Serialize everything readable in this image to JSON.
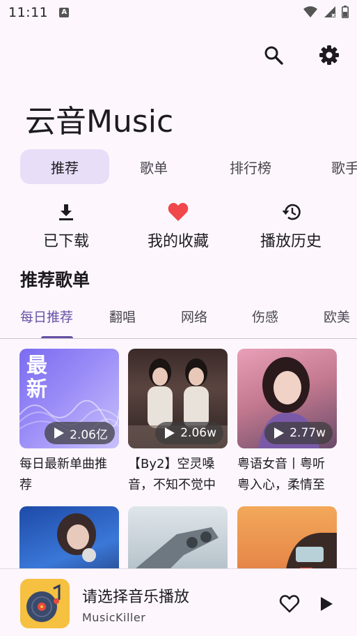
{
  "status_bar": {
    "time": "11:11"
  },
  "app": {
    "title": "云音Music"
  },
  "icons": {
    "search": "search-icon",
    "settings": "gear-icon"
  },
  "main_tabs": [
    "推荐",
    "歌单",
    "排行榜",
    "歌手"
  ],
  "quick_actions": [
    {
      "label": "已下载",
      "icon": "download-icon"
    },
    {
      "label": "我的收藏",
      "icon": "heart-icon"
    },
    {
      "label": "播放历史",
      "icon": "history-icon"
    }
  ],
  "section": {
    "title": "推荐歌单"
  },
  "sub_tabs": [
    "每日推荐",
    "翻唱",
    "网络",
    "伤感",
    "欧美"
  ],
  "playlists": [
    {
      "title": "每日最新单曲推荐",
      "plays": "2.06亿",
      "cover_text": "最新"
    },
    {
      "title": "【By2】空灵嗓音，不知不觉中",
      "plays": "2.06w"
    },
    {
      "title": "粤语女音丨粤听粤入心，柔情至",
      "plays": "2.77w"
    },
    {
      "title": "",
      "plays": ""
    },
    {
      "title": "",
      "plays": ""
    },
    {
      "title": "",
      "plays": ""
    }
  ],
  "player": {
    "title": "请选择音乐播放",
    "subtitle": "MusicKiller"
  },
  "colors": {
    "accent": "#6750a4",
    "active_tab_bg": "#e8def8",
    "background": "#fdf7fd",
    "heart": "#f0484b"
  }
}
